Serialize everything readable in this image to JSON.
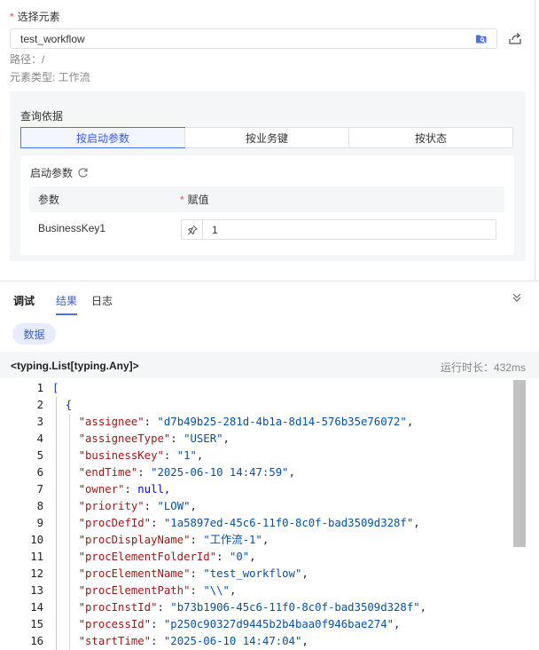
{
  "element": {
    "label": "选择元素",
    "required_mark": "*",
    "value": "test_workflow",
    "path_line": "路径：/",
    "type_line": "元素类型: 工作流"
  },
  "query": {
    "title": "查询依据",
    "tabs": [
      "按启动参数",
      "按业务键",
      "按状态"
    ],
    "active_tab": 0,
    "params_title": "启动参数",
    "col_param": "参数",
    "col_value_mark": "*",
    "col_value": "赋值",
    "row_key": "BusinessKey1",
    "row_value": "1"
  },
  "panel_tabs": {
    "debug": "调试",
    "result": "结果",
    "log": "日志",
    "active": "结果"
  },
  "data_pill": "数据",
  "result": {
    "type_text": "<typing.List[typing.Any]>",
    "runtime_text": "运行时长：432ms"
  },
  "code_lines": [
    {
      "n": "1",
      "text": "["
    },
    {
      "n": "2",
      "text": "  {"
    },
    {
      "n": "3",
      "key": "assignee",
      "val": "\"d7b49b25-281d-4b1a-8d14-576b35e76072\"",
      "kind": "s"
    },
    {
      "n": "4",
      "key": "assigneeType",
      "val": "\"USER\"",
      "kind": "s"
    },
    {
      "n": "5",
      "key": "businessKey",
      "val": "\"1\"",
      "kind": "s"
    },
    {
      "n": "6",
      "key": "endTime",
      "val": "\"2025-06-10 14:47:59\"",
      "kind": "s"
    },
    {
      "n": "7",
      "key": "owner",
      "val": "null",
      "kind": "n"
    },
    {
      "n": "8",
      "key": "priority",
      "val": "\"LOW\"",
      "kind": "s"
    },
    {
      "n": "9",
      "key": "procDefId",
      "val": "\"1a5897ed-45c6-11f0-8c0f-bad3509d328f\"",
      "kind": "s"
    },
    {
      "n": "10",
      "key": "procDisplayName",
      "val": "\"工作流-1\"",
      "kind": "s"
    },
    {
      "n": "11",
      "key": "procElementFolderId",
      "val": "\"0\"",
      "kind": "s"
    },
    {
      "n": "12",
      "key": "procElementName",
      "val": "\"test_workflow\"",
      "kind": "s"
    },
    {
      "n": "13",
      "key": "procElementPath",
      "val": "\"\\\\\"",
      "kind": "s"
    },
    {
      "n": "14",
      "key": "procInstId",
      "val": "\"b73b1906-45c6-11f0-8c0f-bad3509d328f\"",
      "kind": "s"
    },
    {
      "n": "15",
      "key": "processId",
      "val": "\"p250c90327d9445b2b4baa0f946bae274\"",
      "kind": "s"
    },
    {
      "n": "16",
      "key": "startTime",
      "val": "\"2025-06-10 14:47:04\"",
      "kind": "s"
    }
  ],
  "scrollbar": {
    "thumb_fraction": 0.62
  },
  "colors": {
    "accent": "#4c6ef5",
    "required": "#e34d59",
    "string": "#0451a5",
    "key": "#a31515"
  },
  "icons": [
    "folder-icon",
    "share-icon",
    "refresh-icon",
    "pin-icon",
    "chevrons-down-icon"
  ]
}
